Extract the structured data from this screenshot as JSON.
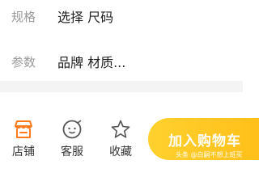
{
  "spec_row": {
    "label": "规格",
    "value": "选择 尺码"
  },
  "param_row": {
    "label": "参数",
    "value": "品牌 材质..."
  },
  "bottom_bar": {
    "items": [
      {
        "label": "店铺",
        "icon": "store-icon"
      },
      {
        "label": "客服",
        "icon": "smiley-service-icon"
      },
      {
        "label": "收藏",
        "icon": "star-icon"
      }
    ],
    "cart_button_label": "加入购物车"
  },
  "watermark": "头条 @白嗣不想上班买",
  "colors": {
    "accent": "#ff7a1a",
    "cart": "#ffc61f",
    "label": "#9a9a9a"
  }
}
